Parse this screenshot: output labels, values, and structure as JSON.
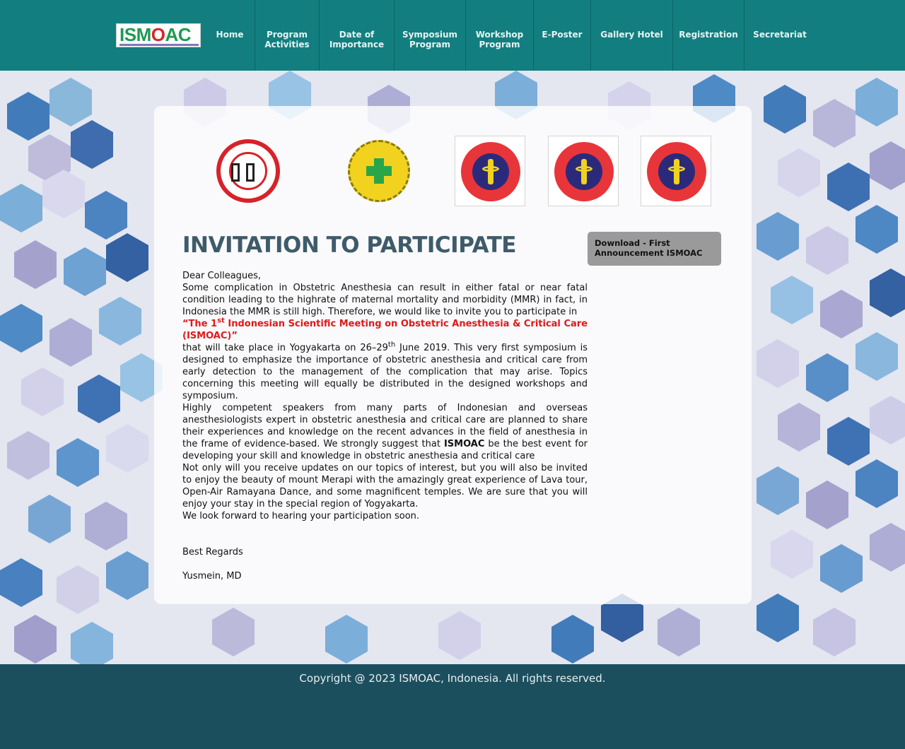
{
  "header": {
    "logo_text": "ISMOAC",
    "nav": [
      {
        "label": "Home"
      },
      {
        "label": "Program\nActivities"
      },
      {
        "label": "Date of\nImportance"
      },
      {
        "label": "Symposium\nProgram"
      },
      {
        "label": "Workshop\nProgram"
      },
      {
        "label": "E-Poster"
      },
      {
        "label": "Gallery Hotel"
      },
      {
        "label": "Registration"
      },
      {
        "label": "Secretariat"
      }
    ]
  },
  "logos": [
    {
      "name": "idi-logo"
    },
    {
      "name": "kemenkes-logo"
    },
    {
      "name": "anesthesia-society-logo-1"
    },
    {
      "name": "anesthesia-society-logo-2"
    },
    {
      "name": "anesthesia-society-logo-3"
    }
  ],
  "main": {
    "title": "INVITATION TO PARTICIPATE",
    "greeting": "Dear Colleagues,",
    "p1_a": "Some complication in Obstetric Anesthesia can result in  either  fatal or near fatal condition leading to the highrate of maternal mortality and morbidity (MMR) in fact, in Indonesia the MMR is still high. Therefore, we would like to invite you to participate in",
    "highlight_a": "“The 1",
    "highlight_sup": "st",
    "highlight_b": " Indonesian Scientific Meeting on Obstetric Anesthesia & Critical Care (ISMOAC)”",
    "p1_b": "that will take place in Yogyakarta on 26–29",
    "p1_sup": "th",
    "p1_c": " June 2019. This very first symposium is designed to emphasize the importance of obstetric anesthesia and critical care from early detection to the management of the complication that may arise. Topics concerning this meeting will equally be distributed in the designed workshops and symposium.",
    "p2_a": "Highly competent speakers from many parts of Indonesian and overseas anesthesiologists expert in obstetric anesthesia and critical care are planned to share their experiences and knowledge on the recent advances in the field of anesthesia in the frame of evidence-based. We strongly suggest that ",
    "p2_bold": "ISMOAC",
    "p2_b": " be the best event for developing your skill and knowledge in obstetric anesthesia and critical care",
    "p3": "Not only will you receive updates on our topics of interest, but you will also be invited to enjoy the beauty of mount Merapi with the amazingly great experience of Lava tour, Open-Air Ramayana Dance, and some magnificent temples. We are sure that you will enjoy your stay in the special region of Yogyakarta.",
    "p4": "We look forward to hearing your participation soon.",
    "regards": "Best Regards",
    "signature": "Yusmein, MD",
    "download_label": "Download - First Announcement ISMOAC"
  },
  "footer": {
    "copyright": "Copyright @ 2023 ISMOAC, Indonesia. All rights reserved."
  },
  "colors": {
    "nav_bg": "#127e7f",
    "footer_bg": "#1b4f5e",
    "title": "#3e5b6a",
    "highlight": "#e01919"
  }
}
